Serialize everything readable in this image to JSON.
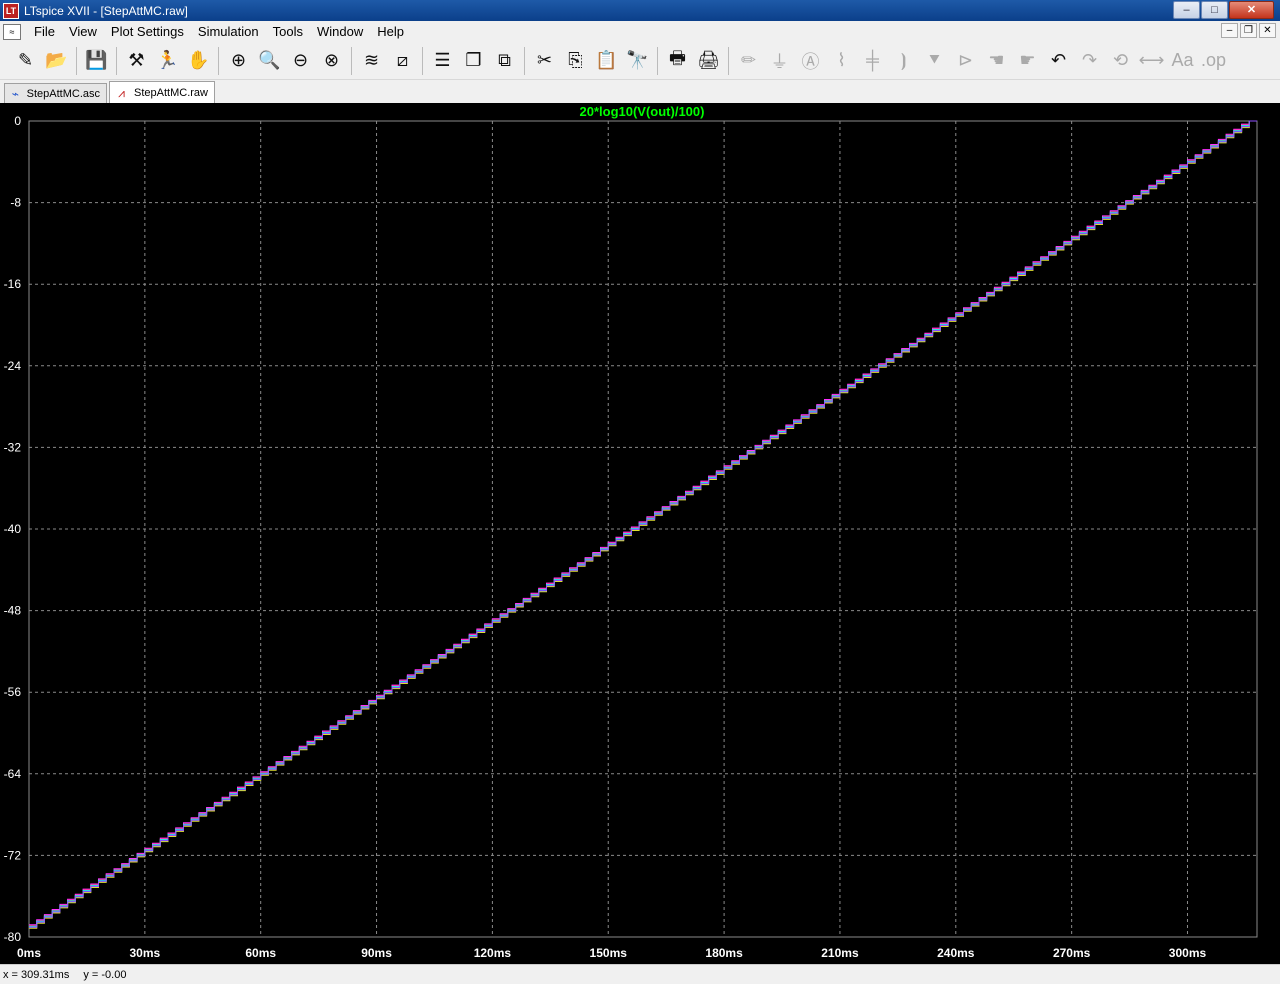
{
  "window": {
    "title": "LTspice XVII - [StepAttMC.raw]",
    "controls": {
      "minimize": "–",
      "maximize": "□",
      "close": "✕"
    }
  },
  "menu": [
    "File",
    "View",
    "Plot Settings",
    "Simulation",
    "Tools",
    "Window",
    "Help"
  ],
  "mdi_controls": {
    "minimize": "–",
    "restore": "❐",
    "close": "✕"
  },
  "toolbar": [
    {
      "name": "new-schematic-icon",
      "glyph": "✎"
    },
    {
      "name": "open-folder-icon",
      "glyph": "📂"
    },
    {
      "sep": true
    },
    {
      "name": "save-icon",
      "glyph": "💾"
    },
    {
      "sep": true
    },
    {
      "name": "control-panel-icon",
      "glyph": "⚒"
    },
    {
      "name": "run-icon",
      "glyph": "🏃"
    },
    {
      "name": "halt-hand-icon",
      "glyph": "✋",
      "dim": true
    },
    {
      "sep": true
    },
    {
      "name": "zoom-in-icon",
      "glyph": "⊕"
    },
    {
      "name": "zoom-fit-icon",
      "glyph": "🔍"
    },
    {
      "name": "zoom-out-icon",
      "glyph": "⊖"
    },
    {
      "name": "zoom-cancel-icon",
      "glyph": "⊗"
    },
    {
      "sep": true
    },
    {
      "name": "autorange-icon",
      "glyph": "≋"
    },
    {
      "name": "manual-limits-icon",
      "glyph": "⧄"
    },
    {
      "sep": true
    },
    {
      "name": "tile-horizontal-icon",
      "glyph": "☰"
    },
    {
      "name": "cascade-icon",
      "glyph": "❐"
    },
    {
      "name": "tile-vertical-icon",
      "glyph": "⧉"
    },
    {
      "sep": true
    },
    {
      "name": "cut-icon",
      "glyph": "✂"
    },
    {
      "name": "copy-icon",
      "glyph": "⎘"
    },
    {
      "name": "paste-icon",
      "glyph": "📋"
    },
    {
      "name": "find-icon",
      "glyph": "🔭"
    },
    {
      "sep": true
    },
    {
      "name": "print-icon",
      "glyph": "🖶"
    },
    {
      "name": "print-setup-icon",
      "glyph": "🖨"
    },
    {
      "sep": true
    },
    {
      "name": "draw-wire-icon",
      "glyph": "✏",
      "dim": true
    },
    {
      "name": "ground-icon",
      "glyph": "⏚",
      "dim": true
    },
    {
      "name": "label-net-icon",
      "glyph": "Ⓐ",
      "dim": true
    },
    {
      "name": "resistor-icon",
      "glyph": "⌇",
      "dim": true
    },
    {
      "name": "capacitor-icon",
      "glyph": "╪",
      "dim": true
    },
    {
      "name": "inductor-icon",
      "glyph": "⦘",
      "dim": true
    },
    {
      "name": "diode-icon",
      "glyph": "⯆",
      "dim": true
    },
    {
      "name": "component-icon",
      "glyph": "⊳",
      "dim": true
    },
    {
      "name": "move-hand-icon",
      "glyph": "☚",
      "dim": true
    },
    {
      "name": "drag-hand-icon",
      "glyph": "☛",
      "dim": true
    },
    {
      "name": "undo-icon",
      "glyph": "↶"
    },
    {
      "name": "redo-icon",
      "glyph": "↷",
      "dim": true
    },
    {
      "name": "rotate-icon",
      "glyph": "⟲",
      "dim": true
    },
    {
      "name": "mirror-icon",
      "glyph": "⟷",
      "dim": true
    },
    {
      "name": "text-icon",
      "glyph": "Aa",
      "dim": true
    },
    {
      "name": "spice-directive-icon",
      "glyph": ".op",
      "dim": true
    }
  ],
  "tabs": [
    {
      "label": "StepAttMC.asc",
      "active": false
    },
    {
      "label": "StepAttMC.raw",
      "active": true
    }
  ],
  "status": {
    "x": "x = 309.31ms",
    "y": "y = -0.00"
  },
  "chart_data": {
    "type": "line",
    "title": "20*log10(V(out)/100)",
    "xlabel": "",
    "ylabel": "",
    "x_unit": "ms",
    "xlim": [
      0,
      318
    ],
    "ylim": [
      -80,
      0
    ],
    "x_ticks": [
      0,
      30,
      60,
      90,
      120,
      150,
      180,
      210,
      240,
      270,
      300
    ],
    "x_tick_labels": [
      "0ms",
      "30ms",
      "60ms",
      "90ms",
      "120ms",
      "150ms",
      "180ms",
      "210ms",
      "240ms",
      "270ms",
      "300ms"
    ],
    "y_ticks": [
      0,
      -8,
      -16,
      -24,
      -32,
      -40,
      -48,
      -56,
      -64,
      -72,
      -80
    ],
    "y_tick_labels": [
      "0",
      "-8",
      "-16",
      "-24",
      "-32",
      "-40",
      "-48",
      "-56",
      "-64",
      "-72",
      "-80"
    ],
    "grid": true,
    "step": {
      "x_step_ms": 2,
      "start_db": -79,
      "db_per_step": 0.5,
      "end_db": 0
    },
    "series_colors": [
      "#1f3fff",
      "#ff3030",
      "#30d030",
      "#ff30ff",
      "#e0e030",
      "#30e0e0",
      "#9050ff"
    ],
    "series_offsets_db": [
      0,
      0.12,
      -0.1,
      0.2,
      -0.15,
      0.06,
      -0.05
    ],
    "colors": {
      "title": "#00ff00",
      "axis_text": "#ffffff",
      "grid": "#8a8a8a",
      "background": "#000000"
    }
  }
}
